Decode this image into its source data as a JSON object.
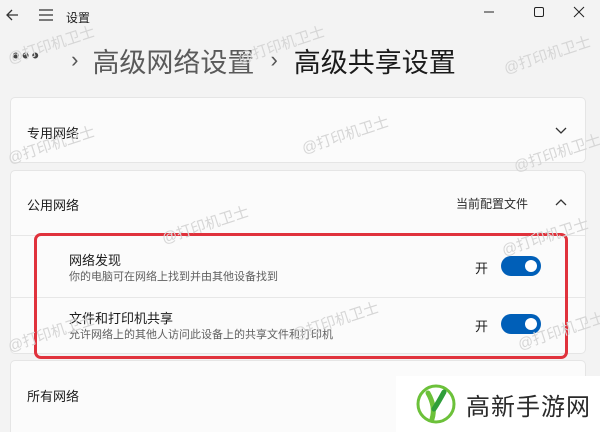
{
  "window": {
    "title": "设置"
  },
  "breadcrumb": {
    "more": "•••",
    "parent": "高级网络设置",
    "current": "高级共享设置"
  },
  "sections": {
    "private": {
      "label": "专用网络"
    },
    "public": {
      "label": "公用网络",
      "profile_tag": "当前配置文件",
      "settings": [
        {
          "title": "网络发现",
          "description": "你的电脑可在网络上找到并由其他设备找到",
          "state_label": "开",
          "enabled": true
        },
        {
          "title": "文件和打印机共享",
          "description": "允许网络上的其他人访问此设备上的共享文件和打印机",
          "state_label": "开",
          "enabled": true
        }
      ]
    },
    "all": {
      "label": "所有网络"
    }
  },
  "watermark": "@打印机卫士",
  "logo": {
    "text": "高新手游网"
  },
  "colors": {
    "toggle_on": "#005fb8",
    "highlight": "#e0323c",
    "logo_green": "#6cc13a"
  },
  "icons": [
    "back-arrow-icon",
    "menu-icon",
    "minimize-icon",
    "maximize-icon",
    "close-icon",
    "chevron-down-icon",
    "chevron-up-icon"
  ]
}
